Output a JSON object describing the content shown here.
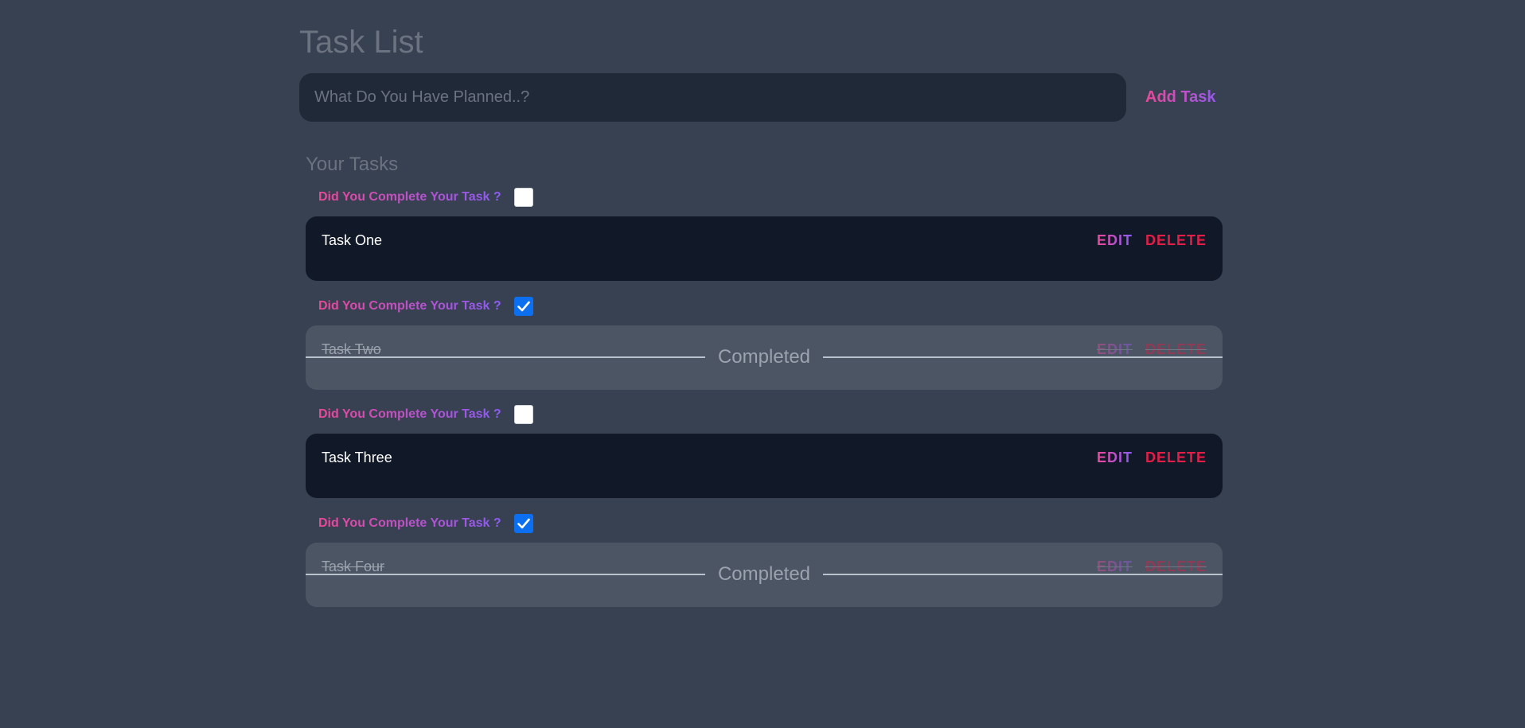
{
  "header": {
    "title": "Task List"
  },
  "new_task": {
    "placeholder": "What Do You Have Planned..?",
    "value": "",
    "add_label": "Add Task"
  },
  "tasks_section": {
    "heading": "Your Tasks"
  },
  "tasks": [
    {
      "complete_prompt": "Did You Complete Your Task ?",
      "completed": false,
      "name": "Task One",
      "edit_label": "EDIT",
      "delete_label": "DELETE",
      "status_label": ""
    },
    {
      "complete_prompt": "Did You Complete Your Task ?",
      "completed": true,
      "name": "Task Two",
      "edit_label": "EDIT",
      "delete_label": "DELETE",
      "status_label": "Completed"
    },
    {
      "complete_prompt": "Did You Complete Your Task ?",
      "completed": false,
      "name": "Task Three",
      "edit_label": "EDIT",
      "delete_label": "DELETE",
      "status_label": ""
    },
    {
      "complete_prompt": "Did You Complete Your Task ?",
      "completed": true,
      "name": "Task Four",
      "edit_label": "EDIT",
      "delete_label": "DELETE",
      "status_label": "Completed"
    }
  ],
  "colors": {
    "background": "#374151",
    "card": "#111827",
    "card_completed": "#4b5563",
    "accent_start": "#ec4899",
    "accent_end": "#8b5cf6",
    "delete": "#e11d48",
    "checkbox_checked": "#0b6ff0"
  },
  "icons": {
    "checked": "checkmark-icon"
  }
}
